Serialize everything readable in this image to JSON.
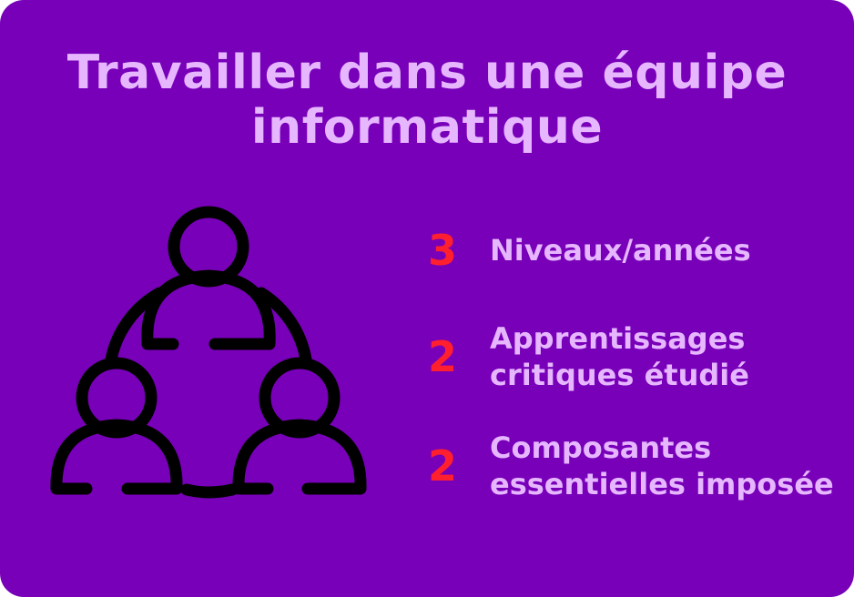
{
  "title": {
    "line1": "Travailler dans une équipe",
    "line2": "informatique"
  },
  "illustration": {
    "icon": "team-people-icon"
  },
  "stats": [
    {
      "number": "3",
      "line1": "Niveaux/années",
      "line2": ""
    },
    {
      "number": "2",
      "line1": "Apprentissages",
      "line2": "critiques étudié"
    },
    {
      "number": "2",
      "line1": "Composantes",
      "line2": "essentielles imposée"
    }
  ],
  "colors": {
    "background": "#7800b8",
    "title": "#e6b6ff",
    "number": "#ff1f2e",
    "label": "#e6b6ff",
    "icon_stroke": "#000000"
  }
}
